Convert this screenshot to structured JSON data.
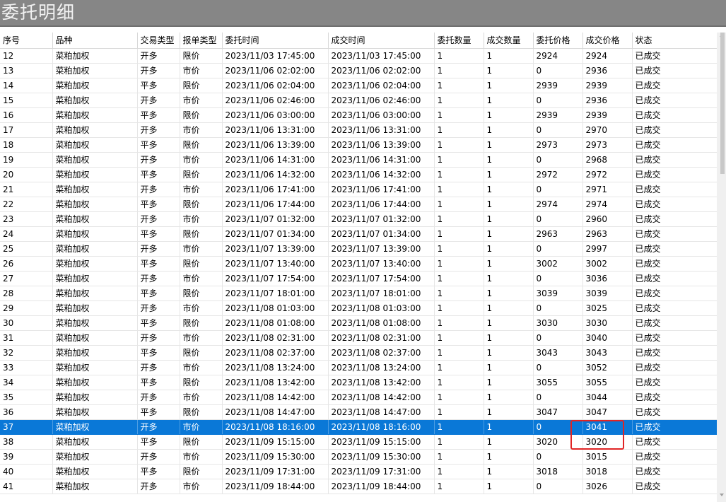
{
  "window": {
    "title": "委托明细"
  },
  "table": {
    "columns": [
      "序号",
      "品种",
      "交易类型",
      "报单类型",
      "委托时间",
      "成交时间",
      "委托数量",
      "成交数量",
      "委托价格",
      "成交价格",
      "状态"
    ],
    "rows": [
      [
        "12",
        "菜粕加权",
        "开多",
        "限价",
        "2023/11/03 17:45:00",
        "2023/11/03 17:45:00",
        "1",
        "1",
        "2924",
        "2924",
        "已成交"
      ],
      [
        "13",
        "菜粕加权",
        "开多",
        "市价",
        "2023/11/06 02:02:00",
        "2023/11/06 02:02:00",
        "1",
        "1",
        "0",
        "2936",
        "已成交"
      ],
      [
        "14",
        "菜粕加权",
        "平多",
        "限价",
        "2023/11/06 02:04:00",
        "2023/11/06 02:04:00",
        "1",
        "1",
        "2939",
        "2939",
        "已成交"
      ],
      [
        "15",
        "菜粕加权",
        "开多",
        "市价",
        "2023/11/06 02:46:00",
        "2023/11/06 02:46:00",
        "1",
        "1",
        "0",
        "2936",
        "已成交"
      ],
      [
        "16",
        "菜粕加权",
        "平多",
        "限价",
        "2023/11/06 03:00:00",
        "2023/11/06 03:00:00",
        "1",
        "1",
        "2939",
        "2939",
        "已成交"
      ],
      [
        "17",
        "菜粕加权",
        "开多",
        "市价",
        "2023/11/06 13:31:00",
        "2023/11/06 13:31:00",
        "1",
        "1",
        "0",
        "2970",
        "已成交"
      ],
      [
        "18",
        "菜粕加权",
        "平多",
        "限价",
        "2023/11/06 13:39:00",
        "2023/11/06 13:39:00",
        "1",
        "1",
        "2973",
        "2973",
        "已成交"
      ],
      [
        "19",
        "菜粕加权",
        "开多",
        "市价",
        "2023/11/06 14:31:00",
        "2023/11/06 14:31:00",
        "1",
        "1",
        "0",
        "2968",
        "已成交"
      ],
      [
        "20",
        "菜粕加权",
        "平多",
        "限价",
        "2023/11/06 14:32:00",
        "2023/11/06 14:32:00",
        "1",
        "1",
        "2972",
        "2972",
        "已成交"
      ],
      [
        "21",
        "菜粕加权",
        "开多",
        "市价",
        "2023/11/06 17:41:00",
        "2023/11/06 17:41:00",
        "1",
        "1",
        "0",
        "2971",
        "已成交"
      ],
      [
        "22",
        "菜粕加权",
        "平多",
        "限价",
        "2023/11/06 17:44:00",
        "2023/11/06 17:44:00",
        "1",
        "1",
        "2974",
        "2974",
        "已成交"
      ],
      [
        "23",
        "菜粕加权",
        "开多",
        "市价",
        "2023/11/07 01:32:00",
        "2023/11/07 01:32:00",
        "1",
        "1",
        "0",
        "2960",
        "已成交"
      ],
      [
        "24",
        "菜粕加权",
        "平多",
        "限价",
        "2023/11/07 01:34:00",
        "2023/11/07 01:34:00",
        "1",
        "1",
        "2963",
        "2963",
        "已成交"
      ],
      [
        "25",
        "菜粕加权",
        "开多",
        "市价",
        "2023/11/07 13:39:00",
        "2023/11/07 13:39:00",
        "1",
        "1",
        "0",
        "2997",
        "已成交"
      ],
      [
        "26",
        "菜粕加权",
        "平多",
        "限价",
        "2023/11/07 13:40:00",
        "2023/11/07 13:40:00",
        "1",
        "1",
        "3002",
        "3002",
        "已成交"
      ],
      [
        "27",
        "菜粕加权",
        "开多",
        "市价",
        "2023/11/07 17:54:00",
        "2023/11/07 17:54:00",
        "1",
        "1",
        "0",
        "3036",
        "已成交"
      ],
      [
        "28",
        "菜粕加权",
        "平多",
        "限价",
        "2023/11/07 18:01:00",
        "2023/11/07 18:01:00",
        "1",
        "1",
        "3039",
        "3039",
        "已成交"
      ],
      [
        "29",
        "菜粕加权",
        "开多",
        "市价",
        "2023/11/08 01:03:00",
        "2023/11/08 01:03:00",
        "1",
        "1",
        "0",
        "3025",
        "已成交"
      ],
      [
        "30",
        "菜粕加权",
        "平多",
        "限价",
        "2023/11/08 01:08:00",
        "2023/11/08 01:08:00",
        "1",
        "1",
        "3030",
        "3030",
        "已成交"
      ],
      [
        "31",
        "菜粕加权",
        "开多",
        "市价",
        "2023/11/08 02:31:00",
        "2023/11/08 02:31:00",
        "1",
        "1",
        "0",
        "3040",
        "已成交"
      ],
      [
        "32",
        "菜粕加权",
        "平多",
        "限价",
        "2023/11/08 02:37:00",
        "2023/11/08 02:37:00",
        "1",
        "1",
        "3043",
        "3043",
        "已成交"
      ],
      [
        "33",
        "菜粕加权",
        "开多",
        "市价",
        "2023/11/08 13:24:00",
        "2023/11/08 13:24:00",
        "1",
        "1",
        "0",
        "3052",
        "已成交"
      ],
      [
        "34",
        "菜粕加权",
        "平多",
        "限价",
        "2023/11/08 13:42:00",
        "2023/11/08 13:42:00",
        "1",
        "1",
        "3055",
        "3055",
        "已成交"
      ],
      [
        "35",
        "菜粕加权",
        "开多",
        "市价",
        "2023/11/08 14:42:00",
        "2023/11/08 14:42:00",
        "1",
        "1",
        "0",
        "3044",
        "已成交"
      ],
      [
        "36",
        "菜粕加权",
        "平多",
        "限价",
        "2023/11/08 14:47:00",
        "2023/11/08 14:47:00",
        "1",
        "1",
        "3047",
        "3047",
        "已成交"
      ],
      [
        "37",
        "菜粕加权",
        "开多",
        "市价",
        "2023/11/08 18:16:00",
        "2023/11/08 18:16:00",
        "1",
        "1",
        "0",
        "3041",
        "已成交"
      ],
      [
        "38",
        "菜粕加权",
        "平多",
        "限价",
        "2023/11/09 15:15:00",
        "2023/11/09 15:15:00",
        "1",
        "1",
        "3020",
        "3020",
        "已成交"
      ],
      [
        "39",
        "菜粕加权",
        "开多",
        "市价",
        "2023/11/09 15:30:00",
        "2023/11/09 15:30:00",
        "1",
        "1",
        "0",
        "3015",
        "已成交"
      ],
      [
        "40",
        "菜粕加权",
        "平多",
        "限价",
        "2023/11/09 17:31:00",
        "2023/11/09 17:31:00",
        "1",
        "1",
        "3018",
        "3018",
        "已成交"
      ],
      [
        "41",
        "菜粕加权",
        "开多",
        "市价",
        "2023/11/09 18:44:00",
        "2023/11/09 18:44:00",
        "1",
        "1",
        "0",
        "3026",
        "已成交"
      ]
    ],
    "selected_row_index": 25
  },
  "colors": {
    "titlebar": "#868686",
    "selection": "#0a78d7",
    "annotation": "#e02424"
  }
}
